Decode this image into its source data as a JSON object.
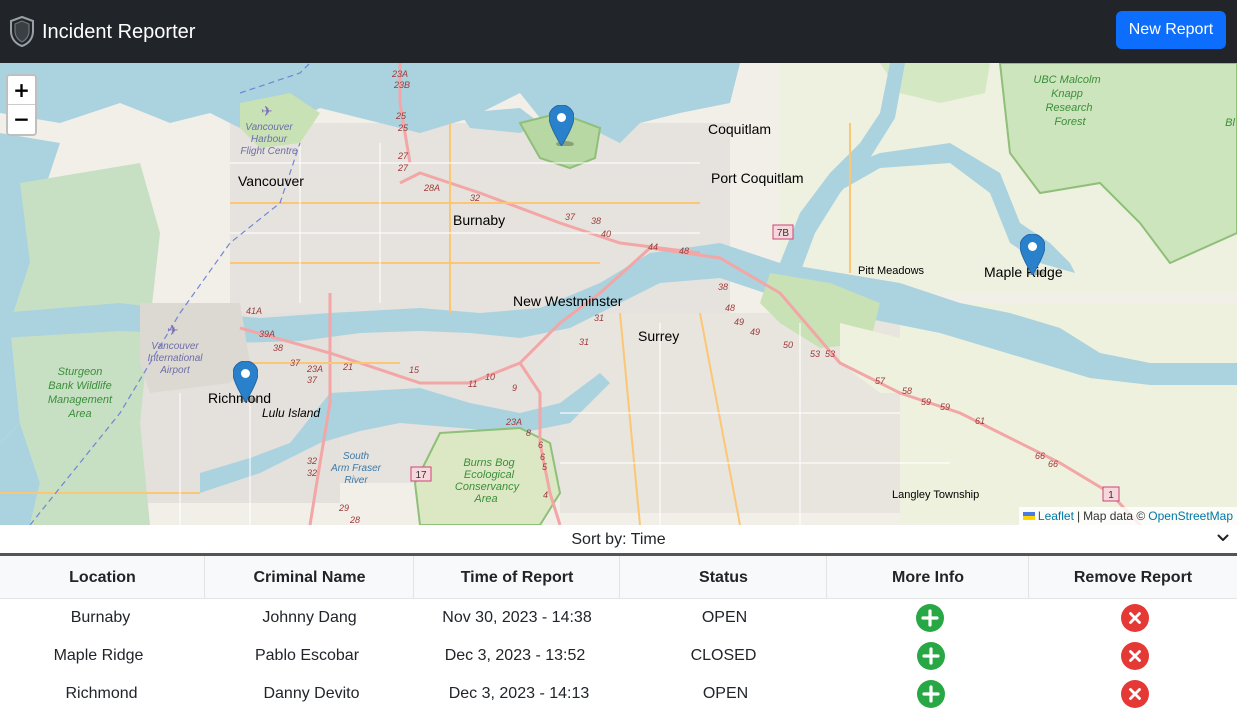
{
  "app": {
    "title": "Incident Reporter",
    "new_report_label": "New Report"
  },
  "map": {
    "zoom_in": "+",
    "zoom_out": "−",
    "labels": {
      "vancouver": "Vancouver",
      "burnaby": "Burnaby",
      "coquitlam": "Coquitlam",
      "port_coquitlam": "Port Coquitlam",
      "pitt_meadows": "Pitt Meadows",
      "maple_ridge": "Maple Ridge",
      "new_westminster": "New Westminster",
      "surrey": "Surrey",
      "richmond": "Richmond",
      "lulu_island": "Lulu Island",
      "langley_township": "Langley Township",
      "uce_knapp_1": "UBC Malcolm",
      "uce_knapp_2": "Knapp",
      "uce_knapp_3": "Research",
      "uce_knapp_4": "Forest",
      "harbour_1": "Vancouver",
      "harbour_2": "Harbour",
      "harbour_3": "Flight Centre",
      "airport_1": "Vancouver",
      "airport_2": "International",
      "airport_3": "Airport",
      "sturgeon_1": "Sturgeon",
      "sturgeon_2": "Bank Wildlife",
      "sturgeon_3": "Management",
      "sturgeon_4": "Area",
      "southarm_1": "South",
      "southarm_2": "Arm Fraser",
      "southarm_3": "River",
      "burnsbog_1": "Burns Bog",
      "burnsbog_2": "Ecological",
      "burnsbog_3": "Conservancy",
      "burnsbog_4": "Area",
      "hwy_7b": "7B",
      "hwy_17": "17",
      "hwy_1": "1",
      "bl": "Bl"
    },
    "route_numbers": [
      "23A",
      "23B",
      "25",
      "25",
      "27",
      "27",
      "28A",
      "32",
      "37",
      "38",
      "40",
      "44",
      "48",
      "38",
      "48",
      "49",
      "49",
      "50",
      "53",
      "53",
      "57",
      "58",
      "59",
      "59",
      "61",
      "66",
      "66",
      "41A",
      "39A",
      "38",
      "37",
      "23A",
      "37",
      "21",
      "15",
      "11",
      "10",
      "9",
      "31",
      "31",
      "23A",
      "8",
      "6",
      "6",
      "5",
      "4",
      "32",
      "32",
      "29",
      "28"
    ],
    "attribution": {
      "leaflet": "Leaflet",
      "sep": "|",
      "text": "Map data ©",
      "osm": "OpenStreetMap"
    }
  },
  "sort": {
    "selected": "Sort by: Time"
  },
  "table": {
    "headers": [
      "Location",
      "Criminal Name",
      "Time of Report",
      "Status",
      "More Info",
      "Remove Report"
    ],
    "rows": [
      {
        "location": "Burnaby",
        "name": "Johnny Dang",
        "time": "Nov 30, 2023 - 14:38",
        "status": "OPEN"
      },
      {
        "location": "Maple Ridge",
        "name": "Pablo Escobar",
        "time": "Dec 3, 2023 - 13:52",
        "status": "CLOSED"
      },
      {
        "location": "Richmond",
        "name": "Danny Devito",
        "time": "Dec 3, 2023 - 14:13",
        "status": "OPEN"
      }
    ]
  },
  "colors": {
    "navbar": "#212529",
    "primary": "#0d6efd",
    "more_info": "#28a745",
    "remove": "#dc3545",
    "marker": "#2a81cb"
  },
  "icons": {
    "brand": "shield-icon",
    "more_info": "plus-circle-icon",
    "remove": "x-circle-icon",
    "marker": "map-marker-icon",
    "sort": "chevron-down-icon"
  }
}
